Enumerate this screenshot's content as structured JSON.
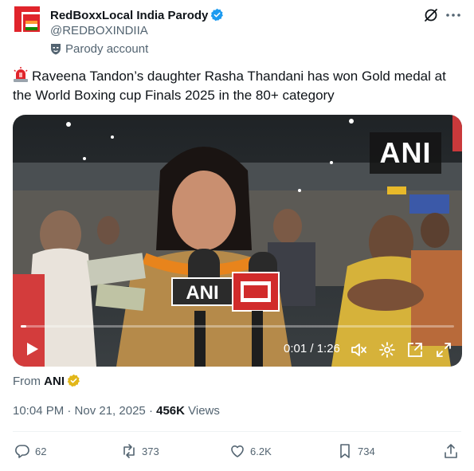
{
  "account": {
    "name": "RedBoxxLocal India Parody",
    "handle": "@REDBOXINDIIA",
    "label": "Parody account"
  },
  "tweet": {
    "text": "Raveena Tandon’s daughter Rasha Thandani has won Gold medal at the World Boxing cup Finals 2025 in the 80+ category",
    "emoji": "rotating-light"
  },
  "video": {
    "watermark": "ANI",
    "mic_label_1": "ANI",
    "time": "0:01 / 1:26",
    "progress": 0.012
  },
  "source": {
    "prefix": "From",
    "name": "ANI"
  },
  "meta": {
    "timestamp": "10:04 PM · Nov 21, 2025",
    "separator": "·",
    "views_count": "456K",
    "views_label": "Views"
  },
  "actions": {
    "replies": "62",
    "reposts": "373",
    "likes": "6.2K",
    "bookmarks": "734"
  },
  "colors": {
    "brand_red": "#e0242b",
    "verified_blue": "#1d9bf0",
    "gold_badge": "#e2b719",
    "text_secondary": "#536471"
  }
}
